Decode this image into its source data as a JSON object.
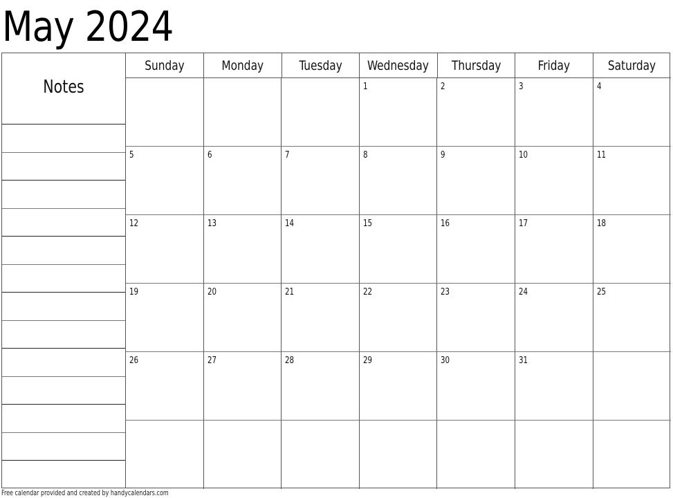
{
  "calendar": {
    "title": "May 2024",
    "notes_label": "Notes",
    "notes_line_count": 13,
    "weekdays": [
      "Sunday",
      "Monday",
      "Tuesday",
      "Wednesday",
      "Thursday",
      "Friday",
      "Saturday"
    ],
    "weeks": [
      [
        "",
        "",
        "",
        "1",
        "2",
        "3",
        "4"
      ],
      [
        "5",
        "6",
        "7",
        "8",
        "9",
        "10",
        "11"
      ],
      [
        "12",
        "13",
        "14",
        "15",
        "16",
        "17",
        "18"
      ],
      [
        "19",
        "20",
        "21",
        "22",
        "23",
        "24",
        "25"
      ],
      [
        "26",
        "27",
        "28",
        "29",
        "30",
        "31",
        ""
      ],
      [
        "",
        "",
        "",
        "",
        "",
        "",
        ""
      ]
    ]
  },
  "footer": {
    "credit": "Free calendar provided and created by handycalendars.com"
  }
}
